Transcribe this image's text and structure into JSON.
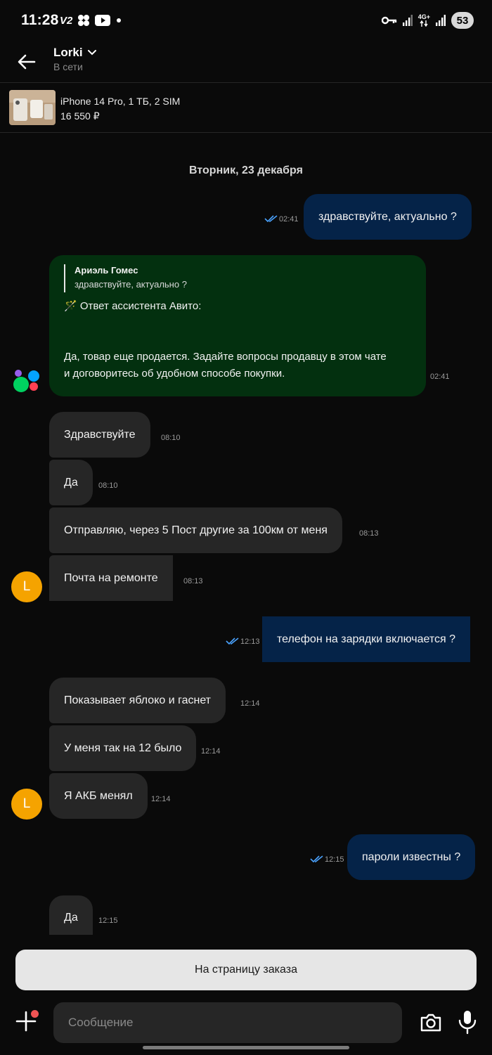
{
  "status_bar": {
    "time": "11:28",
    "carrier_tag": "V2",
    "network": "4G+",
    "battery": "53"
  },
  "header": {
    "title": "Lorki",
    "subtitle": "В сети"
  },
  "product": {
    "title": "iPhone 14 Pro, 1 ТБ, 2 SIM",
    "price": "16 550 ₽"
  },
  "date_separator": "Вторник, 23 декабря",
  "messages": [
    {
      "direction": "out",
      "text": "здравствуйте, актуально ?",
      "time": "02:41"
    },
    {
      "direction": "in",
      "type": "assistant",
      "quote_author": "Ариэль Гомес",
      "quote_text": "здравствуйте, актуально ?",
      "label": "🪄 Ответ ассистента Авито:",
      "text_line1": "Да, товар еще продается. Задайте вопросы продавцу в этом чате",
      "text_line2": "и договоритесь об удобном способе покупки.",
      "time": "02:41"
    },
    {
      "direction": "in",
      "text": "Здравствуйте",
      "time": "08:10"
    },
    {
      "direction": "in",
      "text": "Да",
      "time": "08:10"
    },
    {
      "direction": "in",
      "text": "Отправляю, через 5 Пост другие за 100км от меня",
      "time": "08:13"
    },
    {
      "direction": "in",
      "text": "Почта на ремонте",
      "time": "08:13"
    },
    {
      "direction": "out",
      "text": "телефон на зарядки включается ?",
      "time": "12:13"
    },
    {
      "direction": "in",
      "text": "Показывает яблоко и гаснет",
      "time": "12:14"
    },
    {
      "direction": "in",
      "text": "У меня так на 12 было",
      "time": "12:14"
    },
    {
      "direction": "in",
      "text": "Я АКБ менял",
      "time": "12:14"
    },
    {
      "direction": "out",
      "text": "пароли известны ?",
      "time": "12:15"
    },
    {
      "direction": "in",
      "text": "Да",
      "time": "12:15"
    }
  ],
  "avatar_letter": "L",
  "order_button": "На страницу заказа",
  "composer": {
    "placeholder": "Сообщение"
  },
  "colors": {
    "background": "#0a0a0a",
    "incoming_bubble": "#262626",
    "outgoing_bubble": "#052348",
    "assistant_bubble": "#03300f",
    "avatar": "#f5a300",
    "read_ticks": "#4aa3ff"
  }
}
